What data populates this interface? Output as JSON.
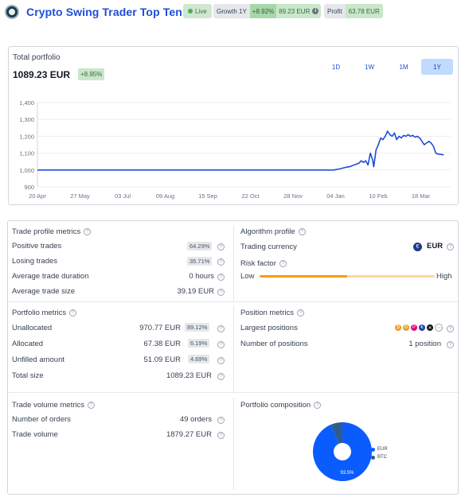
{
  "header": {
    "title": "Crypto Swing Trader Top Ten",
    "live": "Live",
    "growth_label": "Growth 1Y",
    "growth_pct": "+8.92%",
    "growth_value": "89.23 EUR",
    "profit_label": "Profit",
    "profit_value": "63.78 EUR"
  },
  "portfolio": {
    "label": "Total portfolio",
    "value": "1089.23 EUR",
    "change": "+8.95%",
    "periods": [
      "1D",
      "1W",
      "1M",
      "1Y"
    ],
    "active_period": "1Y"
  },
  "chart_data": {
    "type": "line",
    "y_ticks": [
      "1,400",
      "1,300",
      "1,200",
      "1,100",
      "1,000",
      "900"
    ],
    "x_ticks": [
      "20 Apr",
      "27 May",
      "03 Jul",
      "09 Aug",
      "15 Sep",
      "22 Oct",
      "28 Nov",
      "04 Jan",
      "10 Feb",
      "18 Mar"
    ],
    "ylim": [
      900,
      1400
    ],
    "x_range_days": [
      0,
      360
    ],
    "series": [
      {
        "color": "#1d4ed8",
        "points": [
          [
            0,
            1000
          ],
          [
            250,
            1000
          ],
          [
            258,
            1000
          ],
          [
            264,
            1008
          ],
          [
            268,
            1015
          ],
          [
            272,
            1020
          ],
          [
            276,
            1030
          ],
          [
            280,
            1040
          ],
          [
            282,
            1055
          ],
          [
            284,
            1045
          ],
          [
            286,
            1055
          ],
          [
            288,
            1030
          ],
          [
            290,
            1100
          ],
          [
            292,
            1060
          ],
          [
            293,
            1020
          ],
          [
            295,
            1120
          ],
          [
            297,
            1150
          ],
          [
            299,
            1190
          ],
          [
            301,
            1180
          ],
          [
            303,
            1200
          ],
          [
            305,
            1230
          ],
          [
            307,
            1210
          ],
          [
            309,
            1200
          ],
          [
            311,
            1220
          ],
          [
            313,
            1180
          ],
          [
            315,
            1200
          ],
          [
            317,
            1190
          ],
          [
            319,
            1205
          ],
          [
            321,
            1200
          ],
          [
            323,
            1210
          ],
          [
            325,
            1200
          ],
          [
            327,
            1205
          ],
          [
            329,
            1195
          ],
          [
            331,
            1200
          ],
          [
            333,
            1190
          ],
          [
            335,
            1170
          ],
          [
            337,
            1150
          ],
          [
            339,
            1160
          ],
          [
            341,
            1170
          ],
          [
            343,
            1160
          ],
          [
            345,
            1140
          ],
          [
            347,
            1100
          ],
          [
            349,
            1095
          ],
          [
            352,
            1092
          ],
          [
            354,
            1090
          ]
        ]
      }
    ]
  },
  "trade_profile": {
    "title": "Trade profile metrics",
    "rows": [
      {
        "label": "Positive trades",
        "value": "64.29%"
      },
      {
        "label": "Losing trades",
        "value": "35.71%"
      },
      {
        "label": "Average trade duration",
        "value": "0 hours"
      },
      {
        "label": "Average trade size",
        "value": "39.19 EUR"
      }
    ]
  },
  "algorithm_profile": {
    "title": "Algorithm profile",
    "currency_label": "Trading currency",
    "currency_symbol": "€",
    "currency": "EUR",
    "risk_label": "Risk factor",
    "risk_low": "Low",
    "risk_high": "High",
    "risk_level": 0.5
  },
  "portfolio_metrics": {
    "title": "Portfolio metrics",
    "rows": [
      {
        "label": "Unallocated",
        "value": "970.77 EUR",
        "pct": "89.12%"
      },
      {
        "label": "Allocated",
        "value": "67.38 EUR",
        "pct": "6.19%"
      },
      {
        "label": "Unfilled amount",
        "value": "51.09 EUR",
        "pct": "4.69%"
      },
      {
        "label": "Total size",
        "value": "1089.23 EUR",
        "pct": ""
      }
    ]
  },
  "position_metrics": {
    "title": "Position metrics",
    "largest_label": "Largest positions",
    "count_label": "Number of positions",
    "count_value": "1 position",
    "coins": [
      {
        "glyph": "₿",
        "color": "#f7931a"
      },
      {
        "glyph": "Ð",
        "color": "#e0a020"
      },
      {
        "glyph": "P",
        "color": "#e6007a"
      },
      {
        "glyph": "€",
        "color": "#1e40af"
      },
      {
        "glyph": "✕",
        "color": "#111111"
      }
    ]
  },
  "trade_volume": {
    "title": "Trade volume metrics",
    "rows": [
      {
        "label": "Number of orders",
        "value": "49 orders"
      },
      {
        "label": "Trade volume",
        "value": "1879.27 EUR"
      }
    ]
  },
  "composition": {
    "title": "Portfolio composition",
    "legend": [
      {
        "name": "EUR",
        "color": "#0a5cff",
        "value": 93.5
      },
      {
        "name": "BTC",
        "color": "#2f5b8f",
        "value": 6.5
      }
    ],
    "slice_label": "93.5%"
  },
  "colors": {
    "accent": "#1d4ed8",
    "positive_bg": "#c9e7ca",
    "risk": "#f59e0b"
  }
}
